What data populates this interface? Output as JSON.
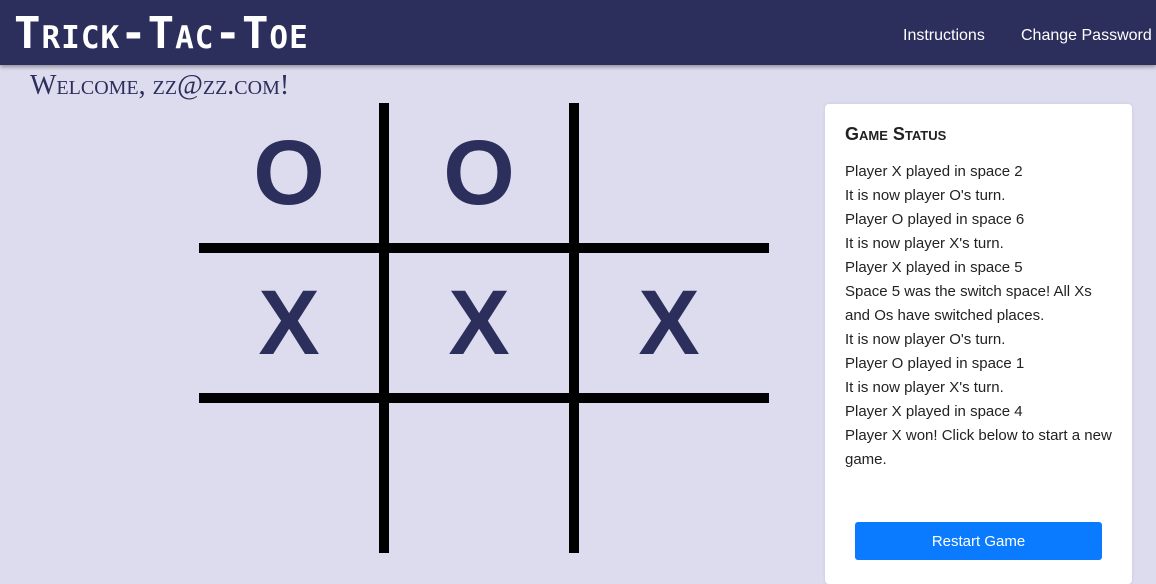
{
  "header": {
    "brand": "Trick-Tac-Toe",
    "nav": [
      {
        "label": "Instructions"
      },
      {
        "label": "Change Password"
      }
    ]
  },
  "welcome": "Welcome, zz@zz.com!",
  "board": {
    "cells": [
      "O",
      "O",
      "",
      "X",
      "X",
      "X",
      "",
      "",
      ""
    ]
  },
  "status": {
    "title": "Game Status",
    "log": [
      "Player X played in space 2",
      "It is now player O's turn.",
      "Player O played in space 6",
      "It is now player X's turn.",
      "Player X played in space 5",
      "Space 5 was the switch space! All Xs and Os have switched places.",
      "It is now player O's turn.",
      "Player O played in space 1",
      "It is now player X's turn.",
      "Player X played in space 4",
      "Player X won! Click below to start a new game."
    ],
    "restart_label": "Restart Game"
  },
  "colors": {
    "navbar": "#2c2e5c",
    "background": "#dcdcee",
    "mark": "#2c2e5c",
    "button": "#0a7bff"
  }
}
